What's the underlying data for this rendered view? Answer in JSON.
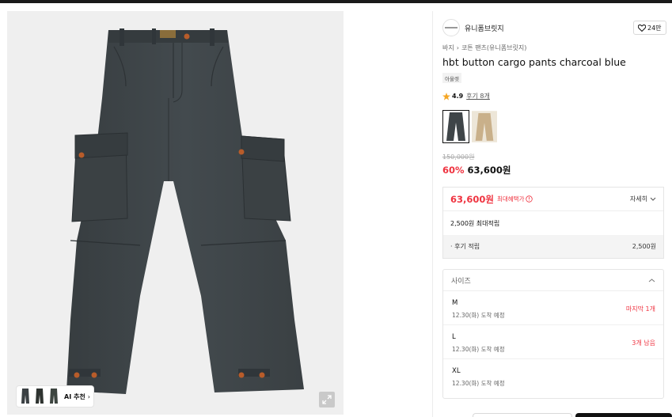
{
  "brand": {
    "name": "유니폼브릿지",
    "logo_text": "UNIFORM BRIDGE",
    "likes": "24만"
  },
  "breadcrumb": [
    "바지",
    "코튼 팬츠(유니폼브릿지)"
  ],
  "product": {
    "name": "hbt button cargo pants charcoal blue",
    "tag": "아울렛",
    "rating": "4.9",
    "reviews": "후기 8개"
  },
  "price": {
    "original": "150,000원",
    "discount": "60%",
    "sale": "63,600원"
  },
  "benefit": {
    "best_price": "63,600원",
    "best_label": "최대혜택가",
    "detail_label": "자세히",
    "points_label": "2,500원 최대적립",
    "review_points_label": "· 후기 적립",
    "review_points_value": "2,500원"
  },
  "size_option": {
    "header": "사이즈",
    "items": [
      {
        "size": "M",
        "eta": "12.30(화) 도착 예정",
        "stock": "마지막 1개"
      },
      {
        "size": "L",
        "eta": "12.30(화) 도착 예정",
        "stock": "3개 남음"
      },
      {
        "size": "XL",
        "eta": "12.30(화) 도착 예정",
        "stock": ""
      }
    ]
  },
  "image": {
    "ai_label": "AI 추천",
    "icons": [
      "expand-icon",
      "chevron-right-icon",
      "heart-icon",
      "star-icon",
      "info-icon",
      "chevron-down-icon",
      "chevron-up-icon"
    ]
  },
  "colors": {
    "accent_red": "#ef3340",
    "star": "#f5a623",
    "pants": "#3f4548"
  }
}
